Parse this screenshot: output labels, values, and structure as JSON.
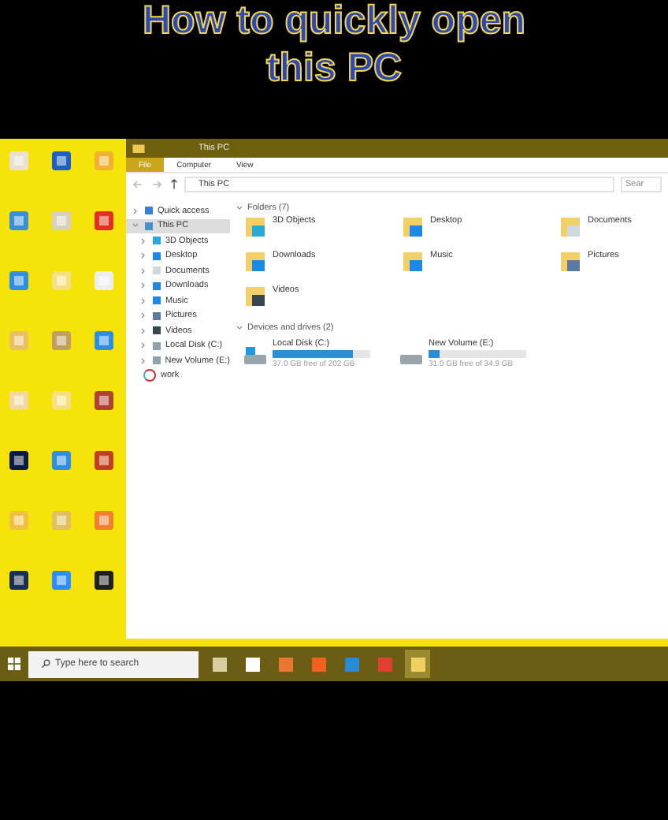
{
  "caption": [
    "How to quickly open",
    "this PC"
  ],
  "window": {
    "title": "This PC"
  },
  "ribbon_tabs": [
    {
      "label": "File",
      "selected": true
    },
    {
      "label": "Computer",
      "selected": false
    },
    {
      "label": "View",
      "selected": false
    }
  ],
  "address": {
    "path": "This PC",
    "search_placeholder": "Sear"
  },
  "nav": [
    {
      "label": "Quick access",
      "kind": "star",
      "selected": false,
      "expanded": false
    },
    {
      "label": "This PC",
      "kind": "pc",
      "selected": true,
      "expanded": true,
      "children": [
        {
          "label": "3D Objects",
          "kind": "cube",
          "selected": false,
          "expanded": false
        },
        {
          "label": "Desktop",
          "kind": "desktop",
          "selected": false,
          "expanded": false
        },
        {
          "label": "Documents",
          "kind": "doc",
          "selected": false,
          "expanded": false
        },
        {
          "label": "Downloads",
          "kind": "download",
          "selected": false,
          "expanded": false
        },
        {
          "label": "Music",
          "kind": "music",
          "selected": false,
          "expanded": false
        },
        {
          "label": "Pictures",
          "kind": "picture",
          "selected": false,
          "expanded": false
        },
        {
          "label": "Videos",
          "kind": "video",
          "selected": false,
          "expanded": false
        },
        {
          "label": "Local Disk (C:)",
          "kind": "disk",
          "selected": false,
          "expanded": false
        },
        {
          "label": "New Volume (E:)",
          "kind": "disk",
          "selected": false,
          "expanded": false
        }
      ]
    },
    {
      "label": "work",
      "kind": "loading",
      "selected": false
    }
  ],
  "folders": {
    "header": "Folders (7)",
    "items": [
      {
        "label": "3D Objects",
        "kind": "cube"
      },
      {
        "label": "Desktop",
        "kind": "desktop"
      },
      {
        "label": "Documents",
        "kind": "doc"
      },
      {
        "label": "Downloads",
        "kind": "download"
      },
      {
        "label": "Music",
        "kind": "music"
      },
      {
        "label": "Pictures",
        "kind": "picture"
      },
      {
        "label": "Videos",
        "kind": "video"
      }
    ]
  },
  "drives": {
    "header": "Devices and drives (2)",
    "items": [
      {
        "label": "Local Disk (C:)",
        "kind": "system",
        "level": 0.82,
        "free": "37.0 GB free of 202 GB"
      },
      {
        "label": "New Volume (E:)",
        "kind": "plain",
        "level": 0.11,
        "free": "31.0 GB free of 34.9 GB"
      }
    ]
  },
  "taskbar": {
    "search_placeholder": "Type here to search",
    "apps": [
      {
        "kind": "taskview",
        "selected": false
      },
      {
        "kind": "store",
        "selected": false
      },
      {
        "kind": "orange",
        "selected": false
      },
      {
        "kind": "orange2",
        "selected": false
      },
      {
        "kind": "code",
        "selected": false
      },
      {
        "kind": "chrome",
        "selected": false
      },
      {
        "kind": "explorer",
        "selected": true
      }
    ]
  }
}
